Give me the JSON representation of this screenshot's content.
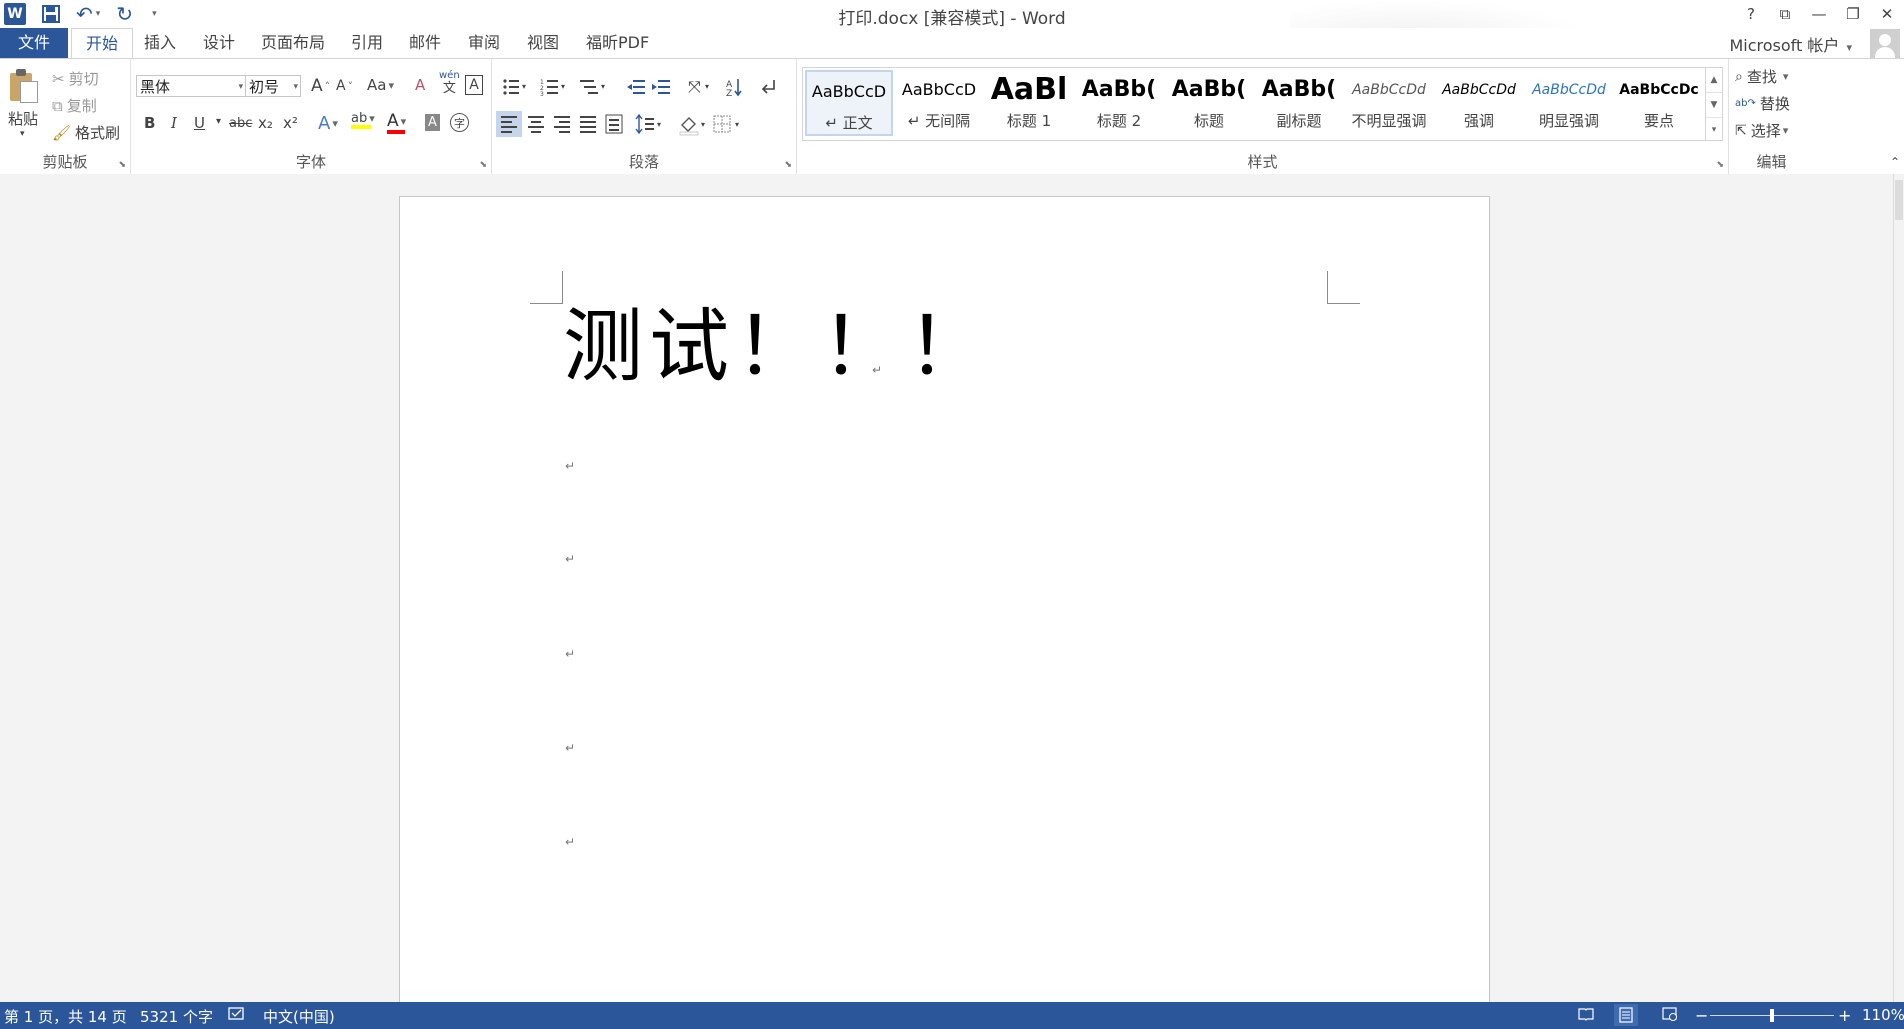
{
  "window": {
    "title": "打印.docx [兼容模式] - Word",
    "controls": [
      "?",
      "⧉",
      "—",
      "❐",
      "✕"
    ]
  },
  "quick_access": {
    "app_icon": "W",
    "items": [
      {
        "icon": "save-icon",
        "glyph": "🖫"
      },
      {
        "icon": "undo-icon",
        "glyph": "↶"
      },
      {
        "icon": "redo-icon",
        "glyph": "↻"
      }
    ],
    "customize_glyph": "▾"
  },
  "tabs": {
    "file": "文件",
    "items": [
      "开始",
      "插入",
      "设计",
      "页面布局",
      "引用",
      "邮件",
      "审阅",
      "视图",
      "福昕PDF"
    ],
    "active": "开始"
  },
  "account": {
    "label": "Microsoft 帐户",
    "caret": "▾"
  },
  "clipboard": {
    "paste": "粘贴",
    "cut": "剪切",
    "copy": "复制",
    "format_painter": "格式刷",
    "group_label": "剪贴板"
  },
  "font": {
    "family": "黑体",
    "size": "初号",
    "group_label": "字体",
    "grow": "A",
    "shrink": "A",
    "change_case": "Aa",
    "clear_format": "A",
    "phonetic": "文",
    "phonetic_top": "wén",
    "char_border": "A",
    "bold": "B",
    "italic": "I",
    "underline": "U",
    "strike": "abc",
    "subscript": "x₂",
    "superscript": "x²",
    "text_effect": "A",
    "highlight": "ab",
    "font_color": "A",
    "char_shading": "A",
    "enclose": "字",
    "highlight_color": "#ffff00",
    "font_color_value": "#ff0000"
  },
  "paragraph": {
    "group_label": "段落"
  },
  "styles": {
    "group_label": "样式",
    "items": [
      {
        "preview": "AaBbCcD",
        "name": "正文",
        "mark": "↵"
      },
      {
        "preview": "AaBbCcD",
        "name": "无间隔",
        "mark": "↵"
      },
      {
        "preview": "AaBl",
        "name": "标题 1",
        "mark": ""
      },
      {
        "preview": "AaBb(",
        "name": "标题 2",
        "mark": ""
      },
      {
        "preview": "AaBb(",
        "name": "标题",
        "mark": ""
      },
      {
        "preview": "AaBb(",
        "name": "副标题",
        "mark": ""
      },
      {
        "preview": "AaBbCcDd",
        "name": "不明显强调",
        "mark": ""
      },
      {
        "preview": "AaBbCcDd",
        "name": "强调",
        "mark": ""
      },
      {
        "preview": "AaBbCcDd",
        "name": "明显强调",
        "mark": ""
      },
      {
        "preview": "AaBbCcDc",
        "name": "要点",
        "mark": ""
      }
    ],
    "accent_color": "#2e75b6"
  },
  "editing": {
    "group_label": "编辑",
    "find": "查找",
    "replace": "替换",
    "select": "选择"
  },
  "document": {
    "heading": "测试！！！",
    "paragraph_mark": "↵"
  },
  "statusbar": {
    "page": "第 1 页，共 14 页",
    "words": "5321 个字",
    "language": "中文(中国)",
    "zoom_minus": "−",
    "zoom_plus": "+",
    "zoom": "110%"
  }
}
